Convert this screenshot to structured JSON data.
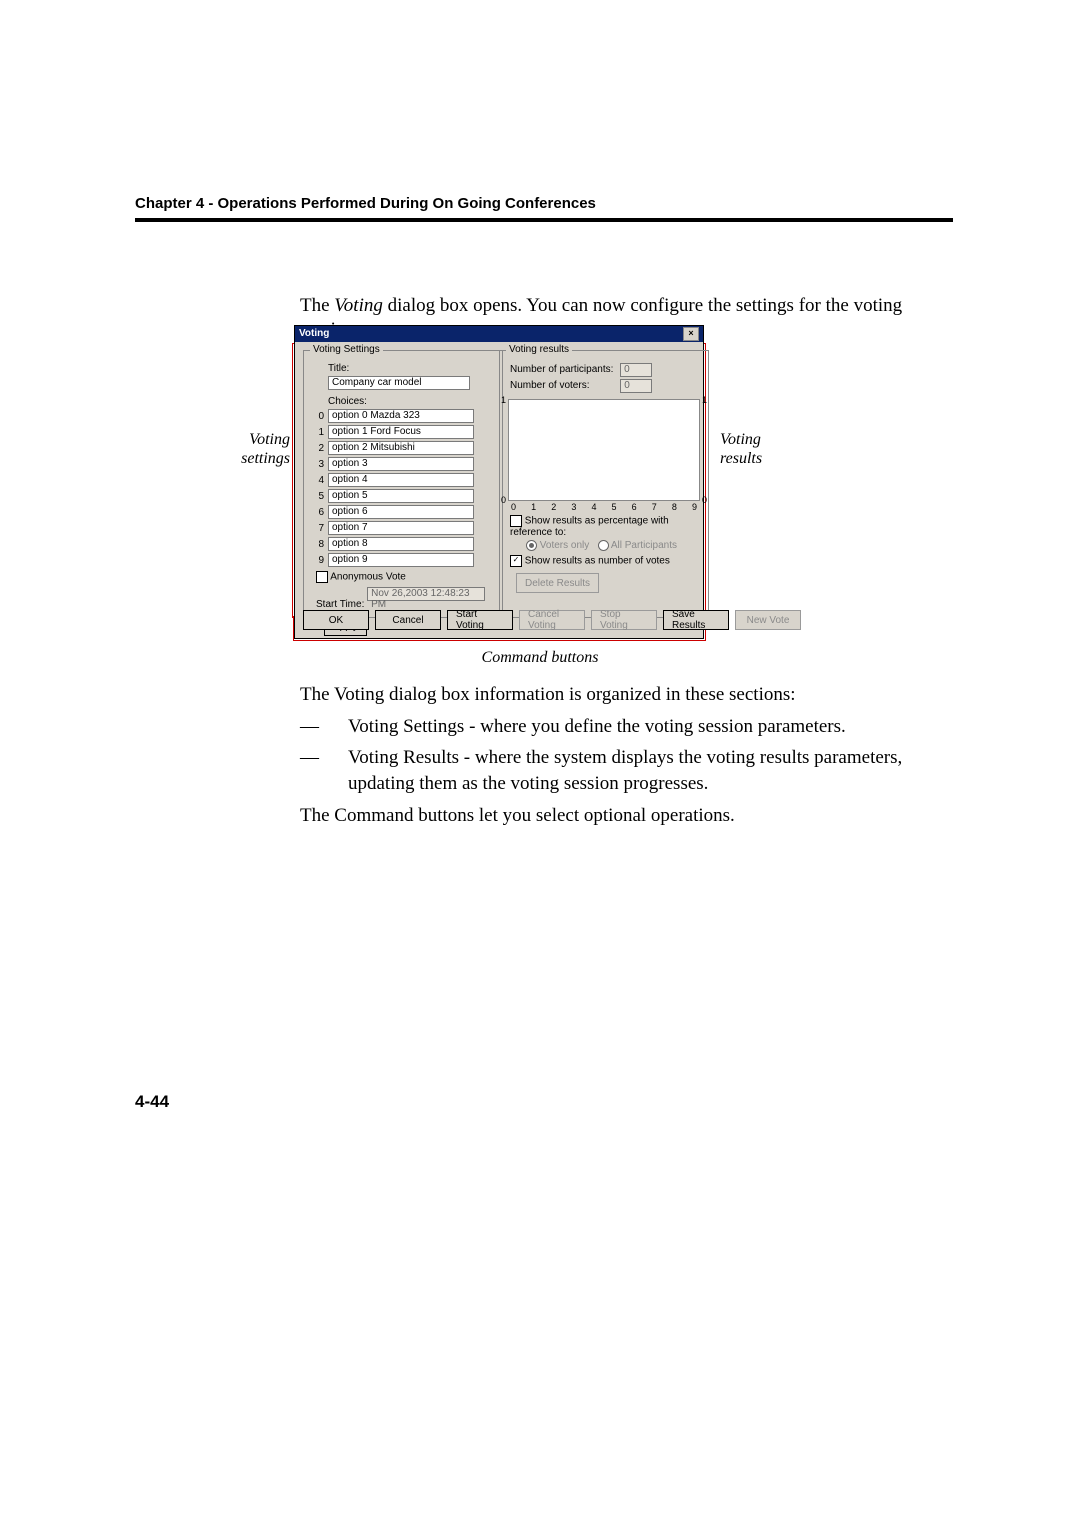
{
  "header": {
    "chapter": "Chapter 4 - Operations Performed During On Going Conferences"
  },
  "intro": {
    "pre": "The ",
    "em": "Voting",
    "post": " dialog box opens. You can now configure the settings for the voting session."
  },
  "side_labels": {
    "left_l1": "Voting",
    "left_l2": "settings",
    "right_l1": "Voting",
    "right_l2": "results"
  },
  "caption": {
    "cmd": "Command buttons"
  },
  "dialog": {
    "title": "Voting",
    "settings_legend": "Voting Settings",
    "title_label": "Title:",
    "title_value": "Company car model",
    "choices_label": "Choices:",
    "choice_nums": [
      "0",
      "1",
      "2",
      "3",
      "4",
      "5",
      "6",
      "7",
      "8",
      "9"
    ],
    "choices": [
      "option 0 Mazda 323",
      "option 1 Ford Focus",
      "option 2 Mitsubishi",
      "option 3",
      "option 4",
      "option 5",
      "option 6",
      "option 7",
      "option 8",
      "option 9"
    ],
    "anonymous_label": "Anonymous Vote",
    "start_time_label": "Start Time:",
    "start_time_value": "Nov 26,2003  12:48:23 PM",
    "apply_label": "Apply",
    "results_legend": "Voting results",
    "participants_label": "Number of participants:",
    "participants_value": "0",
    "voters_label": "Number of voters:",
    "voters_value": "0",
    "show_pct_label": "Show results as percentage with reference to:",
    "voters_only_label": "Voters only",
    "all_participants_label": "All Participants",
    "show_num_label": "Show results as number of votes",
    "delete_results_label": "Delete Results",
    "cmd_ok": "OK",
    "cmd_cancel": "Cancel",
    "cmd_start": "Start Voting",
    "cmd_cancelv": "Cancel Voting",
    "cmd_stop": "Stop Voting",
    "cmd_save": "Save Results",
    "cmd_new": "New Vote"
  },
  "chart_data": {
    "type": "bar",
    "categories": [
      "0",
      "1",
      "2",
      "3",
      "4",
      "5",
      "6",
      "7",
      "8",
      "9"
    ],
    "values": [
      0,
      0,
      0,
      0,
      0,
      0,
      0,
      0,
      0,
      0
    ],
    "title": "",
    "xlabel": "",
    "ylabel": "",
    "ylim": [
      0,
      1
    ],
    "ylim_right": [
      0,
      1
    ]
  },
  "explain": {
    "line1_pre": "The ",
    "line1_em": "Voting",
    "line1_post": " dialog box information is organized in these sections:",
    "b1_em": "Voting Settings",
    "b1_post": " - where you define the voting session parameters.",
    "b2_em": "Voting Results",
    "b2_post": " - where the system displays the voting results parameters, updating them as the voting session progresses.",
    "line2": "The Command buttons let you select optional operations."
  },
  "page_number": "4-44"
}
